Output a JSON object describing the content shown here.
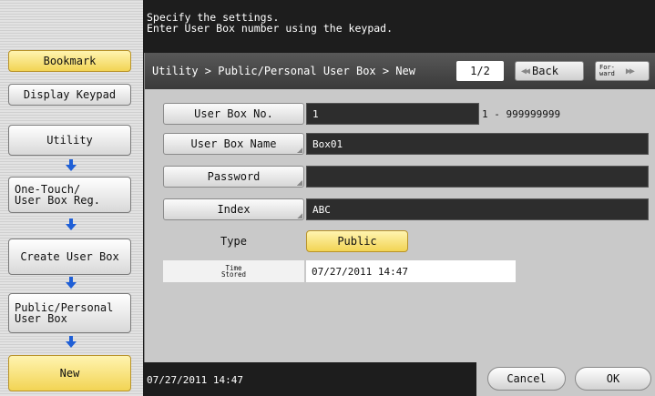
{
  "instruction": {
    "line1": "Specify the settings.",
    "line2": "Enter User Box number using the keypad."
  },
  "sidebar": {
    "bookmark": "Bookmark",
    "display_keypad": "Display Keypad",
    "steps": [
      {
        "label": "Utility"
      },
      {
        "label": "One-Touch/\nUser Box Reg."
      },
      {
        "label": "Create User Box"
      },
      {
        "label": "Public/Personal\nUser Box"
      },
      {
        "label": "New"
      }
    ]
  },
  "header": {
    "breadcrumb": "Utility > Public/Personal User Box > New",
    "page": "1/2",
    "back": "Back",
    "forward_line1": "For-",
    "forward_line2": "ward"
  },
  "form": {
    "user_box_no": {
      "label": "User Box No.",
      "value": "1",
      "range": "1 - 999999999"
    },
    "user_box_name": {
      "label": "User Box Name",
      "value": "Box01"
    },
    "password": {
      "label": "Password",
      "value": ""
    },
    "index": {
      "label": "Index",
      "value": "ABC"
    },
    "type": {
      "label": "Type",
      "value": "Public"
    },
    "time_stored": {
      "label_line1": "Time",
      "label_line2": "Stored",
      "value": "07/27/2011  14:47"
    }
  },
  "footer": {
    "datetime": "07/27/2011   14:47",
    "cancel": "Cancel",
    "ok": "OK"
  },
  "colors": {
    "accent_yellow": "#f2d454",
    "arrow_blue": "#1f5fd6",
    "field_dark": "#2d2d2d"
  }
}
